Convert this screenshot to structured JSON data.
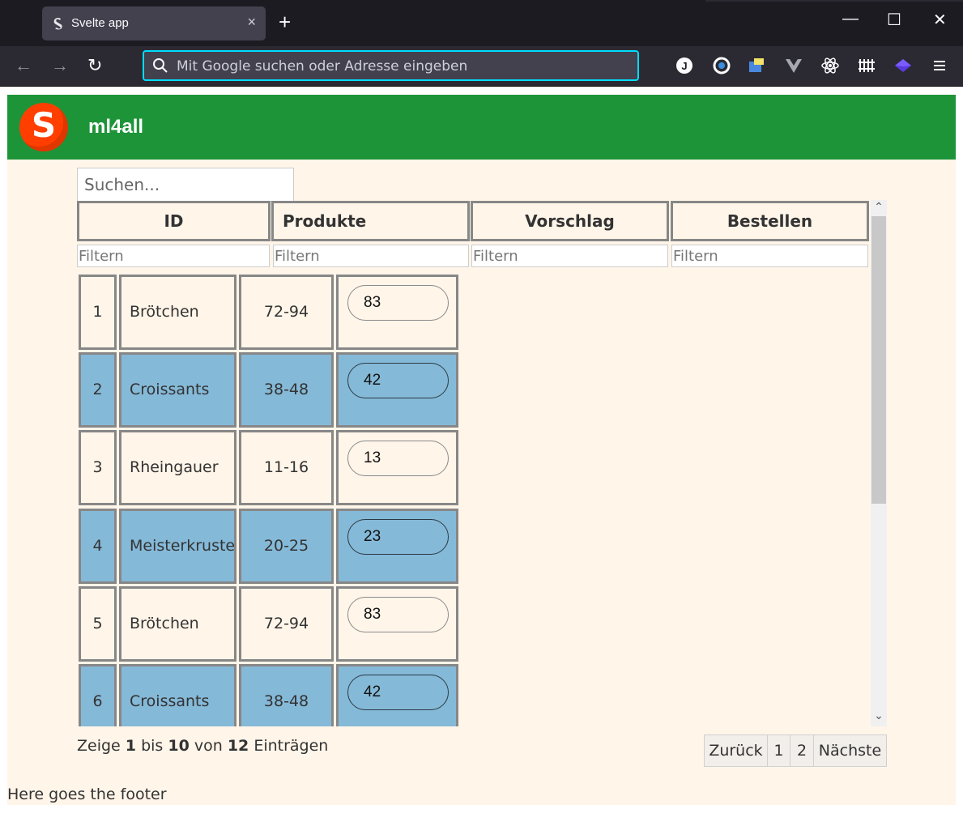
{
  "browser": {
    "tab_title": "Svelte app",
    "tab_close": "×",
    "new_tab": "+",
    "url_placeholder": "Mit Google suchen oder Adresse eingeben",
    "minimize": "—",
    "maximize": "☐",
    "close": "✕",
    "accent_color": "#00ddff"
  },
  "app": {
    "logo_letter": "S",
    "title": "ml4all",
    "header_color": "#1e9439"
  },
  "table": {
    "search_placeholder": "Suchen...",
    "filter_placeholder": "Filtern",
    "headers": [
      "ID",
      "Produkte",
      "Vorschlag",
      "Bestellen"
    ],
    "rows": [
      {
        "id": "1",
        "product": "Brötchen",
        "suggestion": "72-94",
        "order": "83"
      },
      {
        "id": "2",
        "product": "Croissants",
        "suggestion": "38-48",
        "order": "42"
      },
      {
        "id": "3",
        "product": "Rheingauer",
        "suggestion": "11-16",
        "order": "13"
      },
      {
        "id": "4",
        "product": "Meisterkruste",
        "suggestion": "20-25",
        "order": "23"
      },
      {
        "id": "5",
        "product": "Brötchen",
        "suggestion": "72-94",
        "order": "83"
      },
      {
        "id": "6",
        "product": "Croissants",
        "suggestion": "38-48",
        "order": "42"
      }
    ],
    "highlight_color": "#85b9d8"
  },
  "info": {
    "prefix": "Zeige",
    "from": "1",
    "mid": "bis",
    "to": "10",
    "of": "von",
    "total": "12",
    "suffix": "Einträgen"
  },
  "pagination": {
    "prev": "Zurück",
    "pages": [
      "1",
      "2"
    ],
    "next": "Nächste"
  },
  "footer": "Here goes the footer"
}
